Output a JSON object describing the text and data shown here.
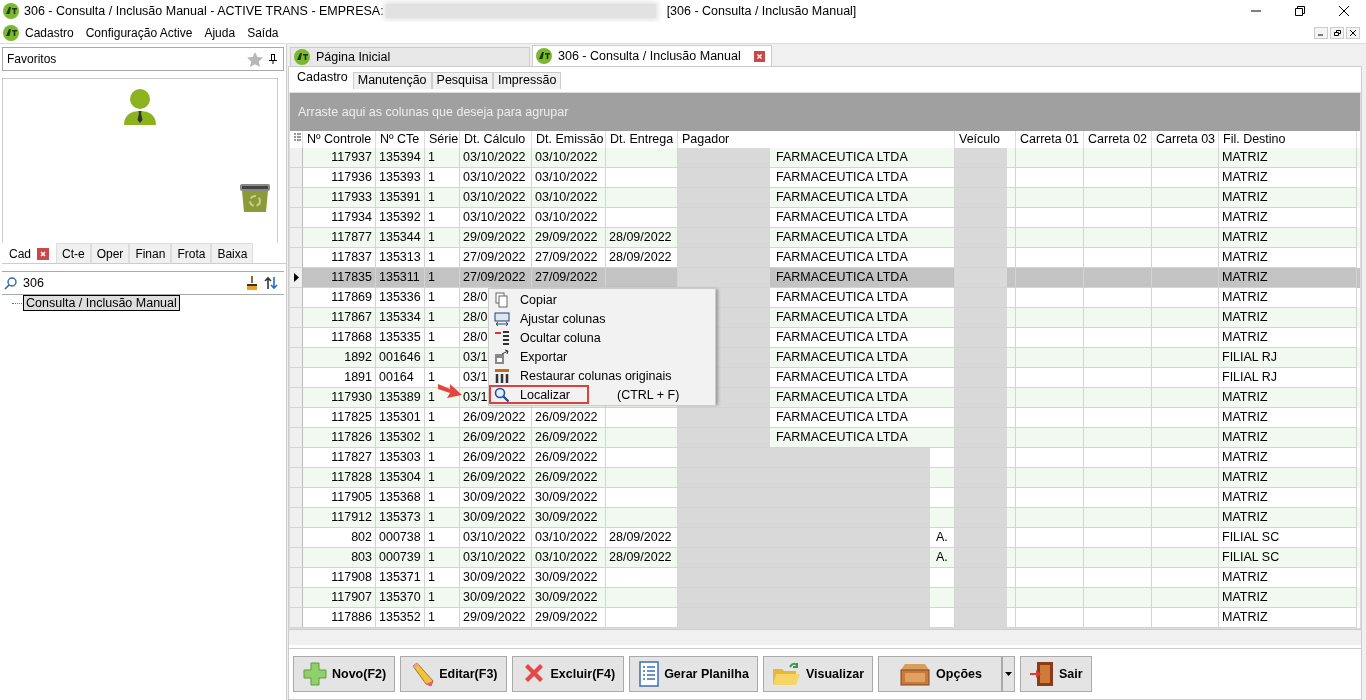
{
  "window": {
    "title": "306 - Consulta / Inclusão Manual - ACTIVE TRANS - EMPRESA:",
    "title_suffix": "[306 - Consulta / Inclusão Manual]"
  },
  "menu_bar": [
    "Cadastro",
    "Configuração Active",
    "Ajuda",
    "Saída"
  ],
  "favorites": {
    "label": "Favoritos"
  },
  "module_tabs": [
    {
      "label": "Cad",
      "selected": true,
      "closable": true
    },
    {
      "label": "Ct-e",
      "selected": false,
      "closable": false
    },
    {
      "label": "Oper",
      "selected": false,
      "closable": false
    },
    {
      "label": "Finan",
      "selected": false,
      "closable": false
    },
    {
      "label": "Frota",
      "selected": false,
      "closable": false
    },
    {
      "label": "Baixa",
      "selected": false,
      "closable": false
    }
  ],
  "search": {
    "value": "306"
  },
  "tree": [
    {
      "label": "Consulta / Inclusão Manual",
      "selected": true
    }
  ],
  "document_tabs": [
    {
      "label": "Página Inicial",
      "selected": false,
      "closable": false
    },
    {
      "label": "306 - Consulta / Inclusão Manual",
      "selected": true,
      "closable": true
    }
  ],
  "form_tabs": [
    {
      "label": "Cadastro",
      "selected": true
    },
    {
      "label": "Manutenção",
      "selected": false
    },
    {
      "label": "Pesquisa",
      "selected": false
    },
    {
      "label": "Impressão",
      "selected": false
    }
  ],
  "group_panel": {
    "hint": "Arraste aqui as colunas que deseja para agrupar"
  },
  "table": {
    "columns": [
      "Nº Controle",
      "Nº CTe",
      "Série",
      "Dt. Cálculo",
      "Dt. Emissão",
      "Dt. Entrega",
      "Pagador",
      "Veículo",
      "Carreta 01",
      "Carreta 02",
      "Carreta 03",
      "Fil. Destino"
    ],
    "rows": [
      {
        "selected": false,
        "pagador_fully_redacted": false,
        "cells": [
          "117937",
          "135394",
          "1",
          "03/10/2022",
          "03/10/2022",
          null,
          "FARMACEUTICA LTDA",
          null,
          null,
          null,
          null,
          "MATRIZ"
        ]
      },
      {
        "selected": false,
        "pagador_fully_redacted": false,
        "cells": [
          "117936",
          "135393",
          "1",
          "03/10/2022",
          "03/10/2022",
          null,
          "FARMACEUTICA LTDA",
          null,
          null,
          null,
          null,
          "MATRIZ"
        ]
      },
      {
        "selected": false,
        "pagador_fully_redacted": false,
        "cells": [
          "117933",
          "135391",
          "1",
          "03/10/2022",
          "03/10/2022",
          null,
          "FARMACEUTICA LTDA",
          null,
          null,
          null,
          null,
          "MATRIZ"
        ]
      },
      {
        "selected": false,
        "pagador_fully_redacted": false,
        "cells": [
          "117934",
          "135392",
          "1",
          "03/10/2022",
          "03/10/2022",
          null,
          "FARMACEUTICA LTDA",
          null,
          null,
          null,
          null,
          "MATRIZ"
        ]
      },
      {
        "selected": false,
        "pagador_fully_redacted": false,
        "cells": [
          "117877",
          "135344",
          "1",
          "29/09/2022",
          "29/09/2022",
          "28/09/2022",
          "FARMACEUTICA LTDA",
          null,
          null,
          null,
          null,
          "MATRIZ"
        ]
      },
      {
        "selected": false,
        "pagador_fully_redacted": false,
        "cells": [
          "117837",
          "135313",
          "1",
          "27/09/2022",
          "27/09/2022",
          "28/09/2022",
          "FARMACEUTICA LTDA",
          null,
          null,
          null,
          null,
          "MATRIZ"
        ]
      },
      {
        "selected": true,
        "pagador_fully_redacted": false,
        "cells": [
          "117835",
          "135311",
          "1",
          "27/09/2022",
          "27/09/2022",
          null,
          "FARMACEUTICA LTDA",
          null,
          null,
          null,
          null,
          "MATRIZ"
        ]
      },
      {
        "selected": false,
        "pagador_fully_redacted": false,
        "cells": [
          "117869",
          "135336",
          "1",
          "28/0",
          null,
          null,
          "FARMACEUTICA LTDA",
          null,
          null,
          null,
          null,
          "MATRIZ"
        ]
      },
      {
        "selected": false,
        "pagador_fully_redacted": false,
        "cells": [
          "117867",
          "135334",
          "1",
          "28/0",
          null,
          null,
          "FARMACEUTICA LTDA",
          null,
          null,
          null,
          null,
          "MATRIZ"
        ]
      },
      {
        "selected": false,
        "pagador_fully_redacted": false,
        "cells": [
          "117868",
          "135335",
          "1",
          "28/0",
          null,
          null,
          "FARMACEUTICA LTDA",
          null,
          null,
          null,
          null,
          "MATRIZ"
        ]
      },
      {
        "selected": false,
        "pagador_fully_redacted": false,
        "cells": [
          "1892",
          "001646",
          "1",
          "03/1",
          null,
          null,
          "FARMACEUTICA LTDA",
          null,
          null,
          null,
          null,
          "FILIAL RJ"
        ]
      },
      {
        "selected": false,
        "pagador_fully_redacted": false,
        "cells": [
          "1891",
          "00164",
          "1",
          "03/1",
          null,
          null,
          "FARMACEUTICA LTDA",
          null,
          null,
          null,
          null,
          "FILIAL RJ"
        ]
      },
      {
        "selected": false,
        "pagador_fully_redacted": false,
        "cells": [
          "117930",
          "135389",
          "1",
          "03/1",
          null,
          null,
          "FARMACEUTICA LTDA",
          null,
          null,
          null,
          null,
          "MATRIZ"
        ]
      },
      {
        "selected": false,
        "pagador_fully_redacted": false,
        "cells": [
          "117825",
          "135301",
          "1",
          "26/09/2022",
          "26/09/2022",
          null,
          "FARMACEUTICA LTDA",
          null,
          null,
          null,
          null,
          "MATRIZ"
        ]
      },
      {
        "selected": false,
        "pagador_fully_redacted": false,
        "cells": [
          "117826",
          "135302",
          "1",
          "26/09/2022",
          "26/09/2022",
          null,
          "FARMACEUTICA LTDA",
          null,
          null,
          null,
          null,
          "MATRIZ"
        ]
      },
      {
        "selected": false,
        "pagador_fully_redacted": true,
        "cells": [
          "117827",
          "135303",
          "1",
          "26/09/2022",
          "26/09/2022",
          null,
          null,
          null,
          null,
          null,
          null,
          "MATRIZ"
        ]
      },
      {
        "selected": false,
        "pagador_fully_redacted": true,
        "cells": [
          "117828",
          "135304",
          "1",
          "26/09/2022",
          "26/09/2022",
          null,
          null,
          null,
          null,
          null,
          null,
          "MATRIZ"
        ]
      },
      {
        "selected": false,
        "pagador_fully_redacted": true,
        "cells": [
          "117905",
          "135368",
          "1",
          "30/09/2022",
          "30/09/2022",
          null,
          null,
          null,
          null,
          null,
          null,
          "MATRIZ"
        ]
      },
      {
        "selected": false,
        "pagador_fully_redacted": true,
        "cells": [
          "117912",
          "135373",
          "1",
          "30/09/2022",
          "30/09/2022",
          null,
          null,
          null,
          null,
          null,
          null,
          "MATRIZ"
        ]
      },
      {
        "selected": false,
        "pagador_fully_redacted": true,
        "cells": [
          "802",
          "000738",
          "1",
          "03/10/2022",
          "03/10/2022",
          "28/09/2022",
          "A.",
          null,
          null,
          null,
          null,
          "FILIAL SC"
        ]
      },
      {
        "selected": false,
        "pagador_fully_redacted": true,
        "cells": [
          "803",
          "000739",
          "1",
          "03/10/2022",
          "03/10/2022",
          "28/09/2022",
          "A.",
          null,
          null,
          null,
          null,
          "FILIAL SC"
        ]
      },
      {
        "selected": false,
        "pagador_fully_redacted": true,
        "cells": [
          "117908",
          "135371",
          "1",
          "30/09/2022",
          "30/09/2022",
          null,
          null,
          null,
          null,
          null,
          null,
          "MATRIZ"
        ]
      },
      {
        "selected": false,
        "pagador_fully_redacted": true,
        "cells": [
          "117907",
          "135370",
          "1",
          "30/09/2022",
          "30/09/2022",
          null,
          null,
          null,
          null,
          null,
          null,
          "MATRIZ"
        ]
      },
      {
        "selected": false,
        "pagador_fully_redacted": true,
        "cells": [
          "117886",
          "135352",
          "1",
          "29/09/2022",
          "29/09/2022",
          null,
          null,
          null,
          null,
          null,
          null,
          "MATRIZ"
        ]
      }
    ]
  },
  "context_menu": {
    "items": [
      {
        "kind": "copy",
        "label": "Copiar",
        "highlighted": false
      },
      {
        "kind": "fit",
        "label": "Ajustar colunas",
        "highlighted": false
      },
      {
        "kind": "hide",
        "label": "Ocultar coluna",
        "highlighted": false
      },
      {
        "kind": "export",
        "label": "Exportar",
        "highlighted": false
      },
      {
        "kind": "restore",
        "label": "Restaurar colunas originais",
        "highlighted": false
      },
      {
        "kind": "find",
        "label": "Localizar",
        "shortcut": "(CTRL + F)",
        "highlighted": true
      }
    ]
  },
  "toolbar": {
    "buttons": [
      {
        "kind": "new",
        "label": "Novo(F2)"
      },
      {
        "kind": "edit",
        "label": "Editar(F3)"
      },
      {
        "kind": "delete",
        "label": "Excluir(F4)"
      },
      {
        "kind": "sheet",
        "label": "Gerar Planilha"
      },
      {
        "kind": "view",
        "label": "Visualizar"
      },
      {
        "kind": "options",
        "label": "Opções"
      },
      {
        "kind": "exit",
        "label": "Sair"
      }
    ]
  }
}
